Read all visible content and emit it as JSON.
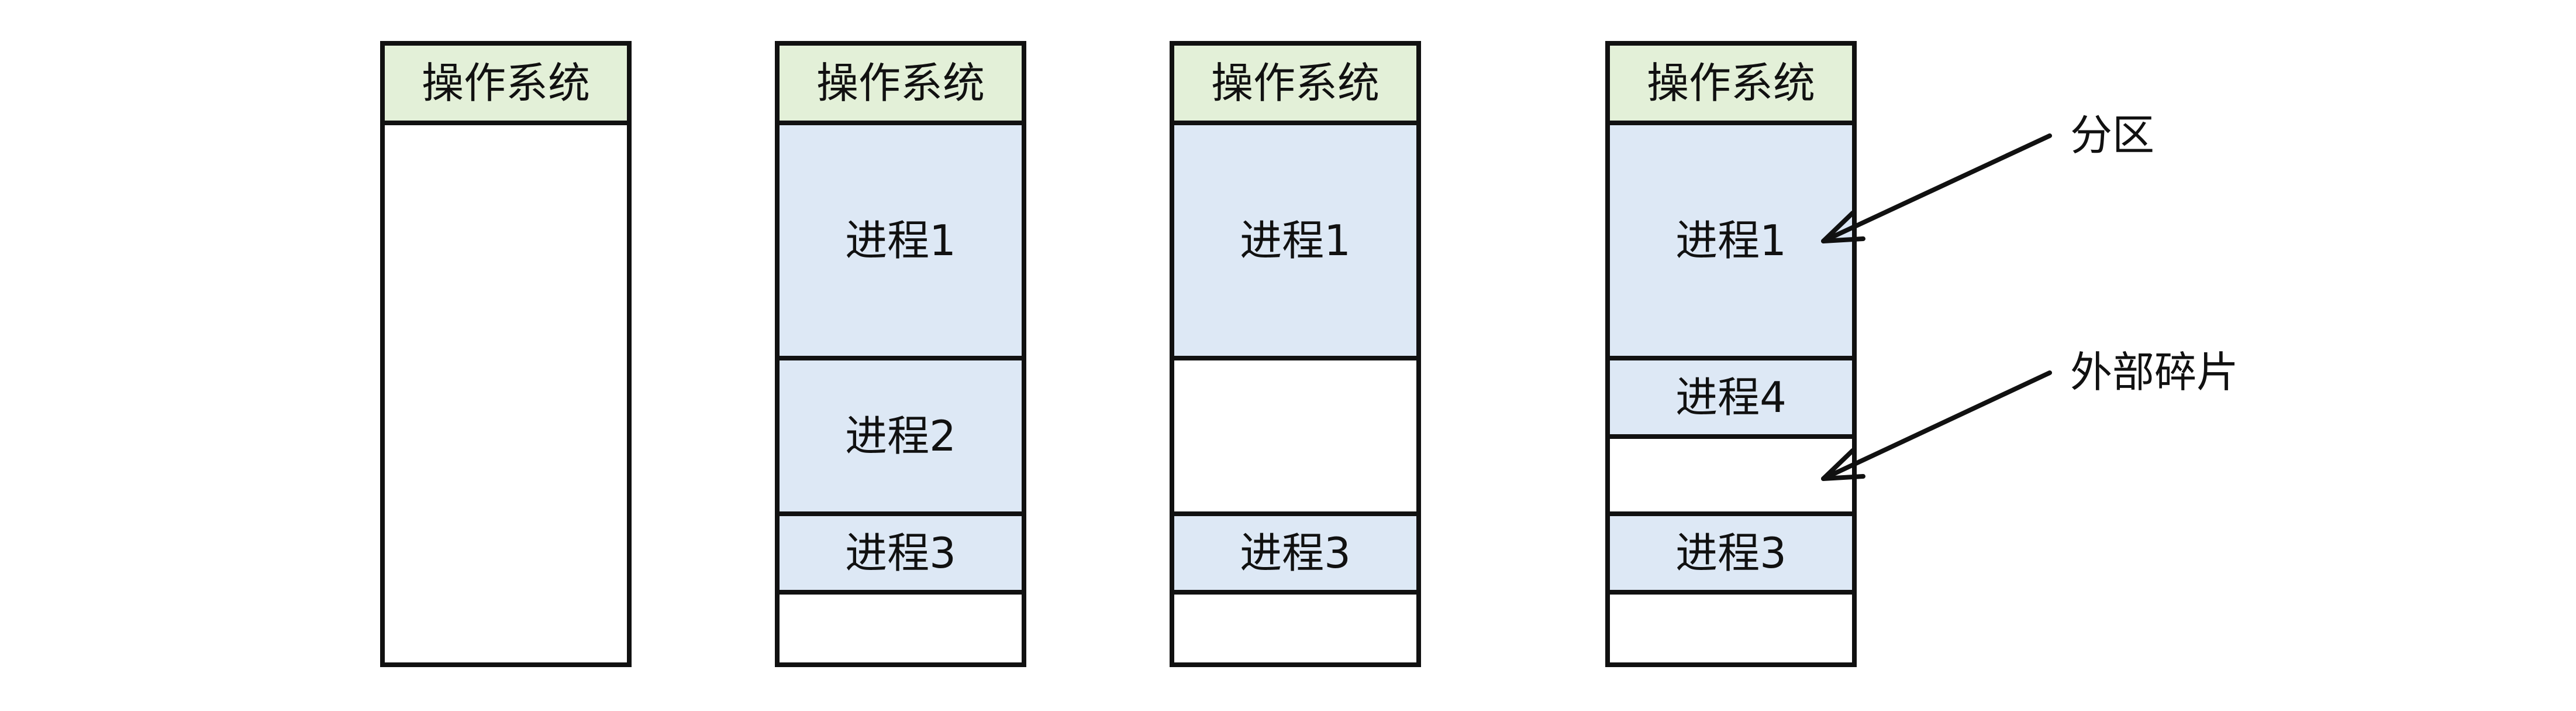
{
  "diagrams": [
    {
      "os": "操作系统",
      "blocks": []
    },
    {
      "os": "操作系统",
      "blocks": [
        "进程1",
        "进程2",
        "进程3"
      ]
    },
    {
      "os": "操作系统",
      "blocks": [
        "进程1",
        "进程3"
      ]
    },
    {
      "os": "操作系统",
      "blocks": [
        "进程1",
        "进程4",
        "进程3"
      ]
    }
  ],
  "annotations": {
    "partition": "分区",
    "external_fragment": "外部碎片"
  }
}
